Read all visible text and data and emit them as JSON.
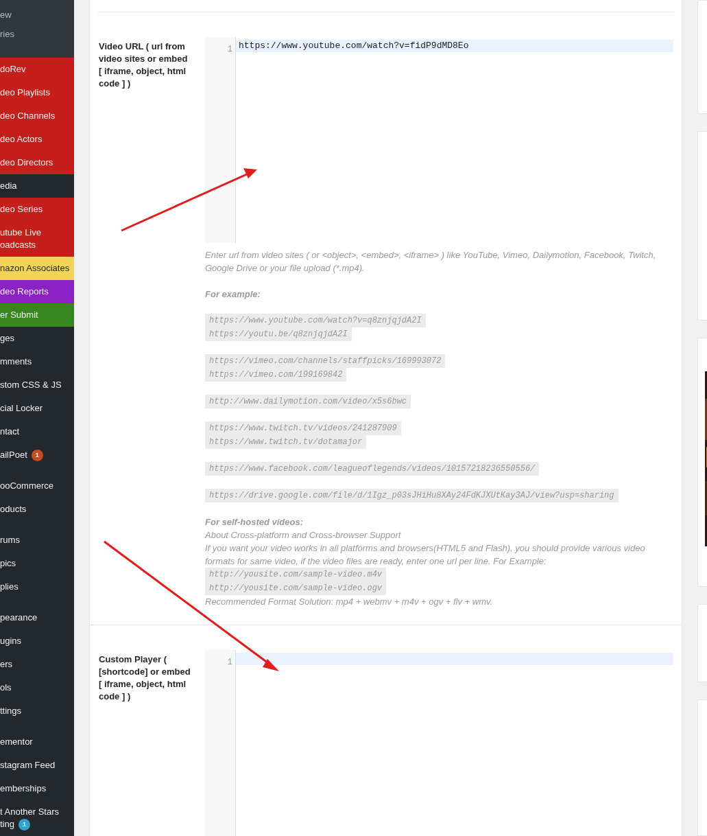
{
  "sidebar": {
    "submenu": [
      "ew",
      "ries"
    ],
    "groups": [
      [
        {
          "label": "doRev",
          "color": "#c41f1a"
        },
        {
          "label": "deo Playlists",
          "color": "#c41f1a"
        },
        {
          "label": "deo Channels",
          "color": "#c41f1a"
        },
        {
          "label": "deo Actors",
          "color": "#c41f1a"
        },
        {
          "label": "deo Directors",
          "color": "#c41f1a"
        },
        {
          "label": "edia"
        },
        {
          "label": "deo Series",
          "color": "#c41f1a"
        },
        {
          "label": "utube Live\noadcasts",
          "color": "#c41f1a"
        },
        {
          "label": "nazon Associates",
          "color": "#f4d458"
        },
        {
          "label": "deo Reports",
          "color": "#8a22c5"
        },
        {
          "label": "er Submit",
          "color": "#37861f"
        },
        {
          "label": "ges"
        },
        {
          "label": "mments"
        },
        {
          "label": "stom CSS & JS"
        },
        {
          "label": "cial Locker"
        },
        {
          "label": "ntact"
        },
        {
          "label": "ailPoet",
          "badge": {
            "text": "1",
            "color": "#ca4a1f"
          }
        }
      ],
      [
        {
          "label": "ooCommerce"
        },
        {
          "label": "oducts"
        }
      ],
      [
        {
          "label": "rums"
        },
        {
          "label": "pics"
        },
        {
          "label": "plies"
        }
      ],
      [
        {
          "label": "pearance"
        },
        {
          "label": "ugins"
        },
        {
          "label": "ers"
        },
        {
          "label": "ols"
        },
        {
          "label": "ttings"
        }
      ],
      [
        {
          "label": "ementor"
        },
        {
          "label": "stagram Feed"
        },
        {
          "label": "emberships"
        },
        {
          "label": "t Another Stars\nting",
          "badge": {
            "text": "1",
            "color": "#2ea2cc"
          }
        }
      ]
    ]
  },
  "fields": [
    {
      "label": "Video URL ( url from video sites or embed [ iframe, object, html code ] )",
      "lines": [
        {
          "number": "1",
          "text": "https://www.youtube.com/watch?v=fidP9dMD8Eo",
          "active": true
        }
      ],
      "help": [
        [
          {
            "kind": "text",
            "text": "Enter url from video sites ( or <object>, <embed>, <iframe> ) like YouTube, Vimeo, Dailymotion, Facebook, Twitch, Google Drive or your file upload (*.mp4)."
          }
        ],
        [
          {
            "kind": "heading",
            "text": "For example:"
          }
        ],
        [
          {
            "kind": "code",
            "text": "https://www.youtube.com/watch?v=q8znjqjdA2I"
          },
          {
            "kind": "code",
            "text": "https://youtu.be/q8znjqjdA2I"
          }
        ],
        [
          {
            "kind": "code",
            "text": "https://vimeo.com/channels/staffpicks/169993072"
          },
          {
            "kind": "code",
            "text": "https://vimeo.com/199169842"
          }
        ],
        [
          {
            "kind": "code",
            "text": "http://www.dailymotion.com/video/x5s6bwc"
          }
        ],
        [
          {
            "kind": "code",
            "text": "https://www.twitch.tv/videos/241287909"
          },
          {
            "kind": "code",
            "text": "https://www.twitch.tv/dotamajor"
          }
        ],
        [
          {
            "kind": "code",
            "text": "https://www.facebook.com/leagueoflegends/videos/10157218236550556/"
          }
        ],
        [
          {
            "kind": "code",
            "text": "https://drive.google.com/file/d/1Igz_p03sJHiHu8XAy24FdKJXUtKay3AJ/view?usp=sharing"
          }
        ],
        [
          {
            "kind": "heading",
            "text": "For self-hosted videos:"
          },
          {
            "kind": "text",
            "text": "About Cross-platform and Cross-browser Support"
          },
          {
            "kind": "text",
            "text": "If you want your video works in all platforms and browsers(HTML5 and Flash), you should provide various video formats for same video, if the video files are ready, enter one url per line. For Example:"
          },
          {
            "kind": "code",
            "text": "http://yousite.com/sample-video.m4v"
          },
          {
            "kind": "code",
            "text": "http://yousite.com/sample-video.ogv"
          },
          {
            "kind": "text",
            "text": "Recommended Format Solution: mp4 + webmv + m4v + ogv + flv + wmv."
          }
        ]
      ]
    },
    {
      "label": "Custom Player ( [shortcode] or embed [ iframe, object, html code ] )",
      "lines": [
        {
          "number": "1",
          "active": true
        }
      ]
    }
  ]
}
